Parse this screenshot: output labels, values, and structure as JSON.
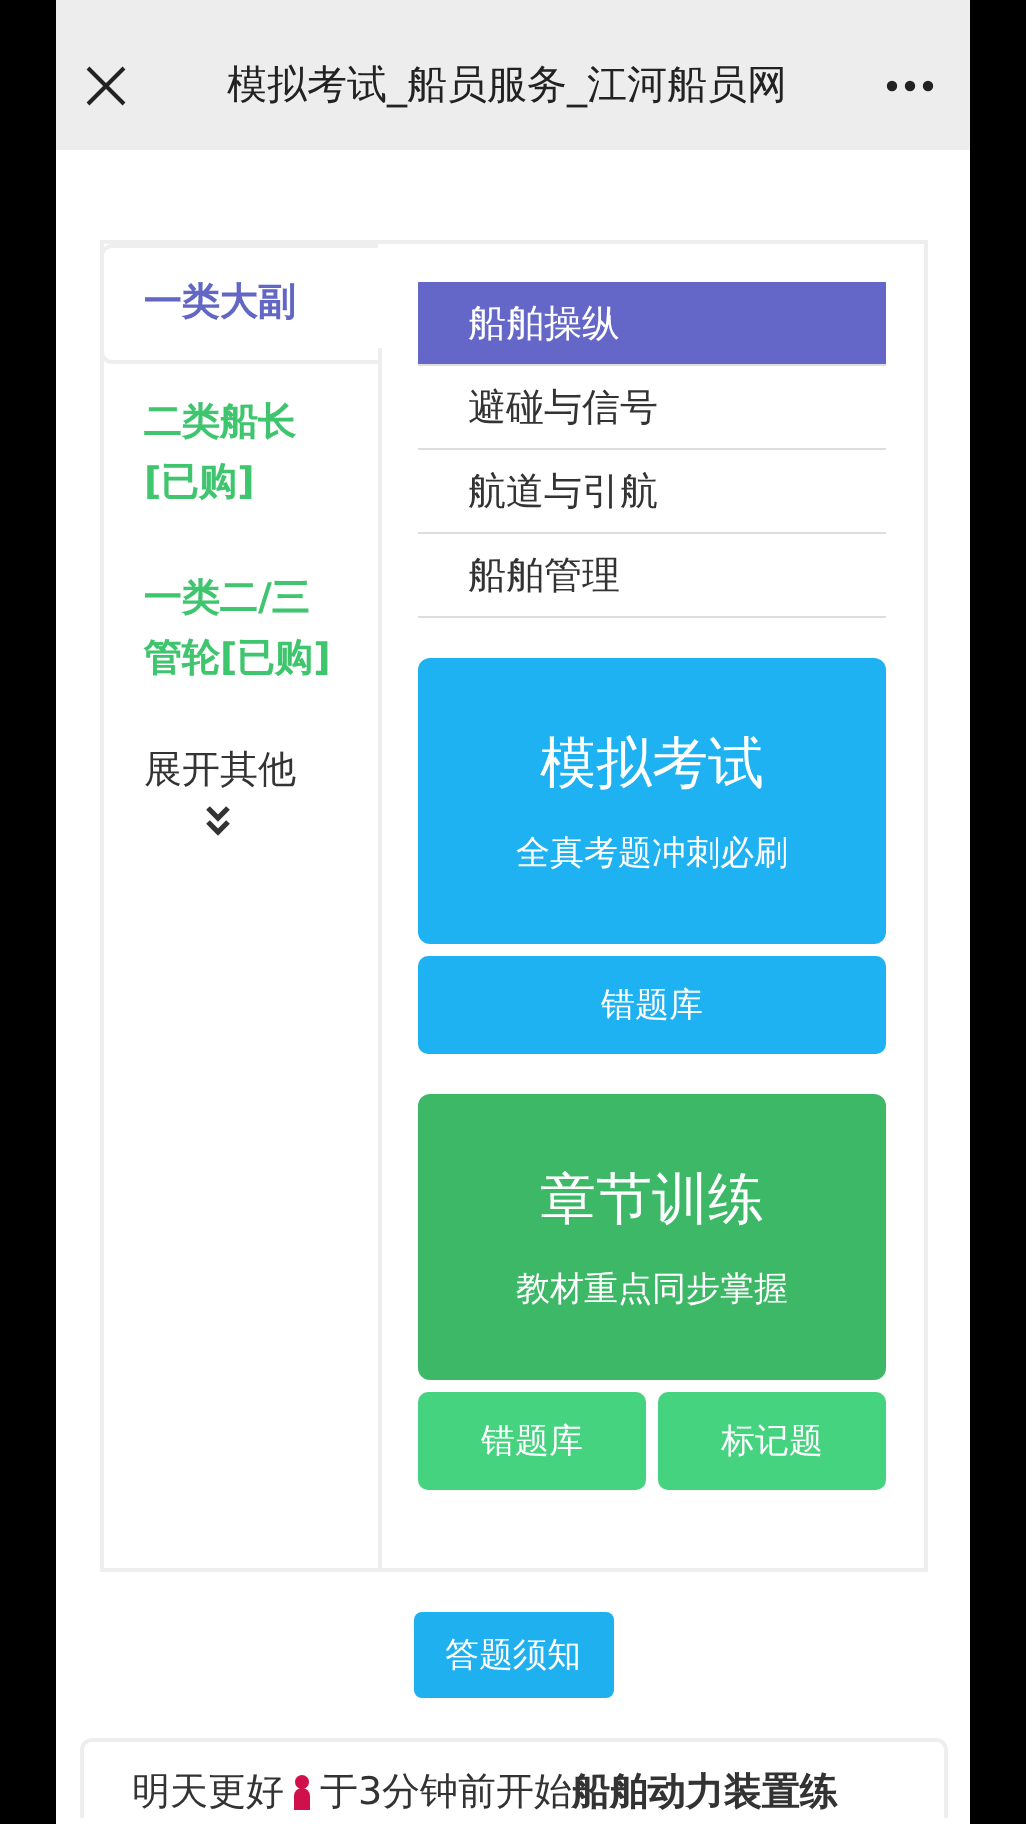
{
  "header": {
    "title": "模拟考试_船员服务_江河船员网"
  },
  "categories": [
    {
      "label": "一类大副",
      "selected": true,
      "purchased": false
    },
    {
      "label": "二类船长[已购]",
      "selected": false,
      "purchased": true
    },
    {
      "label": "一类二/三管轮[已购]",
      "selected": false,
      "purchased": true
    }
  ],
  "expand": {
    "label": "展开其他"
  },
  "subjects": [
    {
      "label": "船舶操纵",
      "selected": true
    },
    {
      "label": "避碰与信号",
      "selected": false
    },
    {
      "label": "航道与引航",
      "selected": false
    },
    {
      "label": "船舶管理",
      "selected": false
    }
  ],
  "exam": {
    "title": "模拟考试",
    "subtitle": "全真考题冲刺必刷",
    "buttons": [
      "错题库"
    ]
  },
  "chapter": {
    "title": "章节训练",
    "subtitle": "教材重点同步掌握",
    "buttons": [
      "错题库",
      "标记题"
    ]
  },
  "notice_button": "答题须知",
  "activity": {
    "user": "明天更好",
    "message": "于3分钟前开始**船舶动力装置练**"
  }
}
